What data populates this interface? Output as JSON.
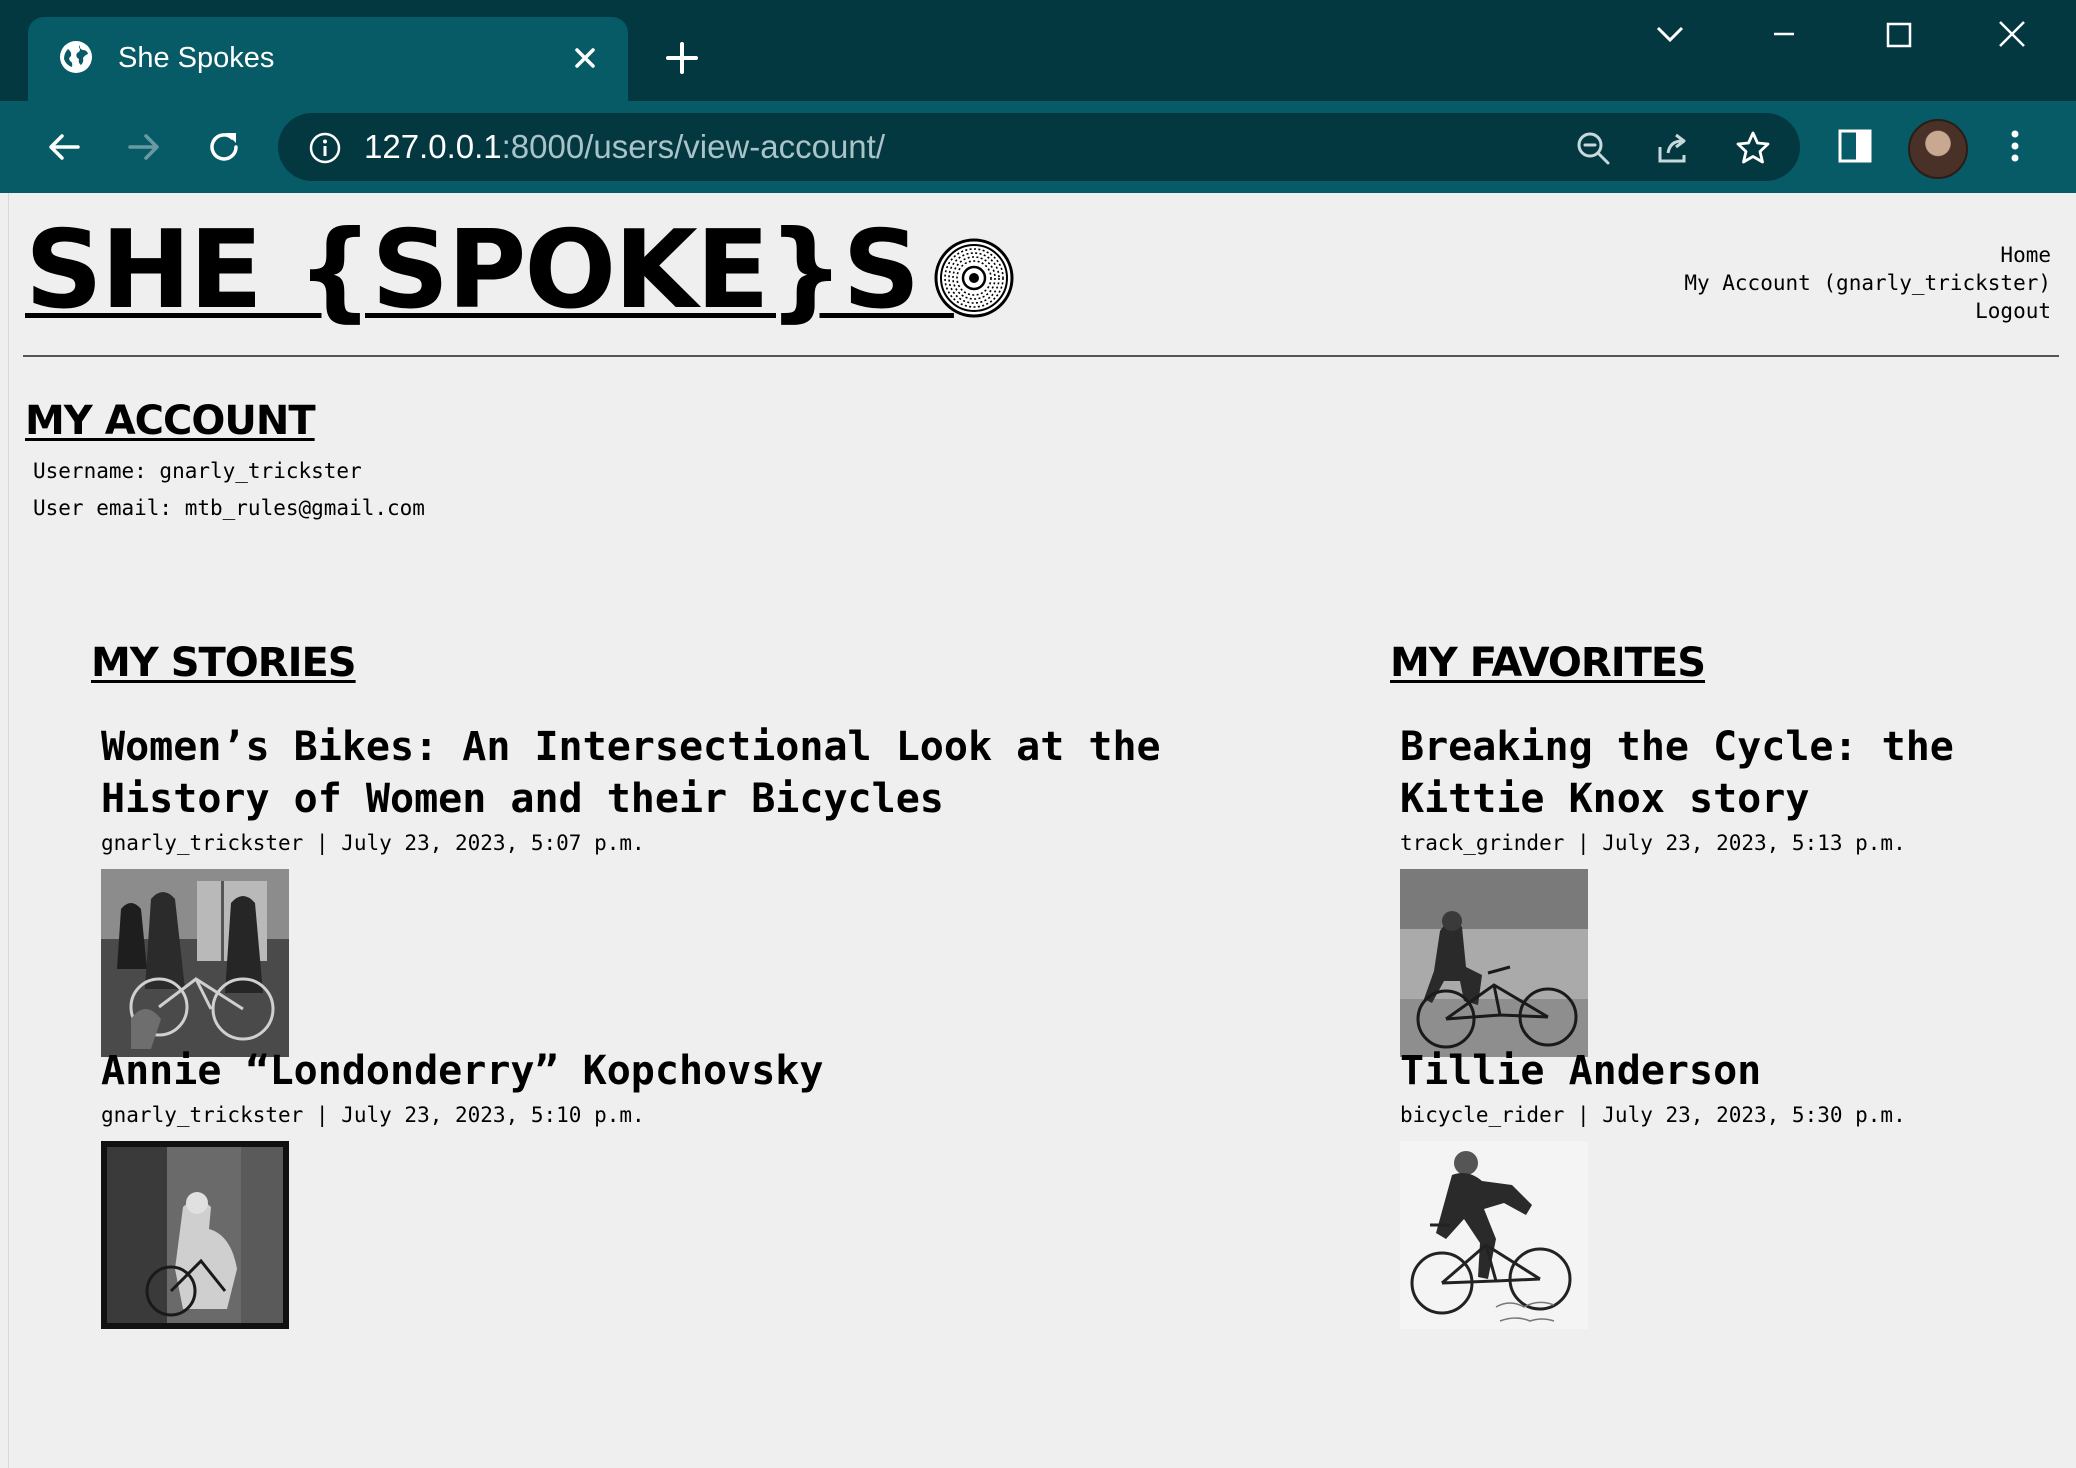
{
  "browser": {
    "tab_title": "She Spokes",
    "url_host": "127.0.0.1",
    "url_path": ":8000/users/view-account/",
    "avatar_icon": "profile-avatar"
  },
  "site": {
    "logo_text": "SHE {SPOKE}S ",
    "logo_icon": "bicycle-wheel-icon",
    "nav": {
      "home": "Home",
      "my_account": "My Account (gnarly_trickster)",
      "logout": "Logout"
    }
  },
  "account": {
    "heading": "MY ACCOUNT",
    "username_line": "Username: gnarly_trickster",
    "email_line": "User email: mtb_rules@gmail.com"
  },
  "my_stories": {
    "heading": "MY STORIES",
    "items": [
      {
        "title": "Women’s Bikes: An Intersectional Look at the History of Women and their Bicycles",
        "meta": "gnarly_trickster | July 23, 2023, 5:07 p.m."
      },
      {
        "title": "Annie “Londonderry” Kopchovsky",
        "meta": "gnarly_trickster | July 23, 2023, 5:10 p.m."
      }
    ]
  },
  "my_favorites": {
    "heading": "MY FAVORITES",
    "items": [
      {
        "title": "Breaking the Cycle: the Kittie Knox story",
        "meta": "track_grinder | July 23, 2023, 5:13 p.m."
      },
      {
        "title": "Tillie Anderson",
        "meta": "bicycle_rider | July 23, 2023, 5:30 p.m."
      }
    ]
  }
}
